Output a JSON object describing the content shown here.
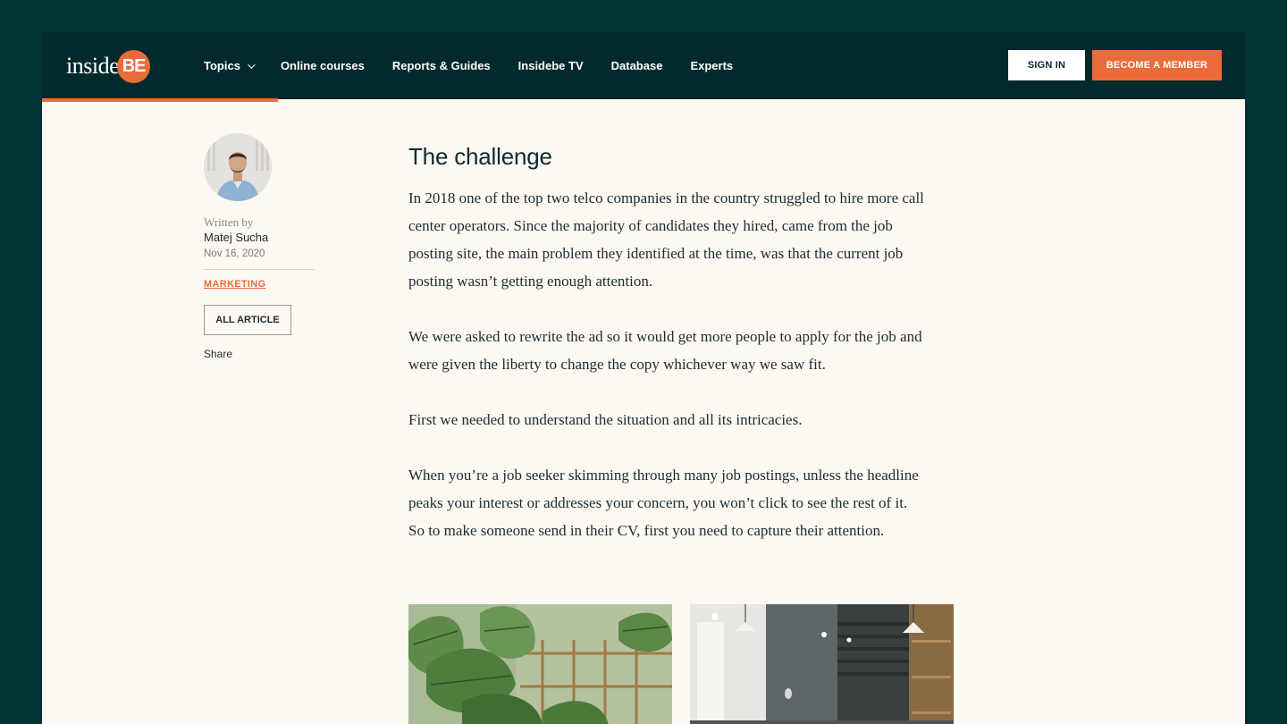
{
  "header": {
    "logo_text": "inside",
    "logo_badge": "BE",
    "nav": [
      {
        "label": "Topics",
        "has_dropdown": true
      },
      {
        "label": "Online courses"
      },
      {
        "label": "Reports & Guides"
      },
      {
        "label": "Insidebe TV"
      },
      {
        "label": "Database"
      },
      {
        "label": "Experts"
      }
    ],
    "sign_in_label": "SIGN IN",
    "member_label": "BECOME A MEMBER"
  },
  "sidebar": {
    "written_by": "Written by",
    "author": "Matej Sucha",
    "date": "Nov 16, 2020",
    "category": "MARKETING",
    "all_article_label": "ALL ARTICLE",
    "share_label": "Share"
  },
  "article": {
    "heading": "The challenge",
    "paragraphs": [
      "In 2018 one of the top two telco companies in the country struggled to hire more call center operators. Since the majority of candidates they hired, came from the job posting site, the main problem they identified at the time, was that the current job posting wasn’t getting enough attention.",
      "We were asked to rewrite the ad so it would get more people to apply for the job and were given the liberty to change the copy whichever way we saw fit.",
      "First we needed to understand the situation and all its intricacies.",
      "When you’re a job seeker skimming through many job postings, unless the headline peaks your interest or addresses your concern, you won’t click to see the rest of it.  So to make someone send in their CV, first you need to capture their attention."
    ]
  },
  "colors": {
    "background": "#033236",
    "header": "#022a2d",
    "accent": "#ec6b3b",
    "page": "#fdf8f2"
  }
}
